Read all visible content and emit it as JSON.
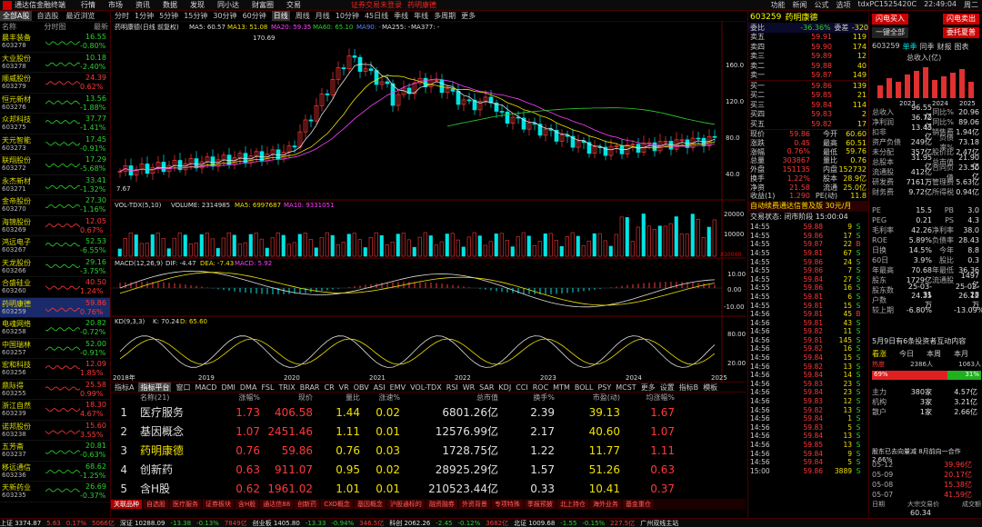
{
  "app": {
    "name": "通达信金融终端",
    "menu": [
      "行情",
      "市场",
      "资讯",
      "数据",
      "发现",
      "同小达",
      "财富圈",
      "交易"
    ],
    "warning": "证券交易未登录",
    "stock_title": "药明康德",
    "right_menu": [
      "功能",
      "新闻",
      "公式",
      "选项",
      "tdxPC1525420C",
      "22:49:04",
      "周二"
    ]
  },
  "left": {
    "tabs": [
      "全部A股",
      "自选股",
      "最近浏览"
    ],
    "head": [
      "名称",
      "分时图",
      "最新"
    ],
    "stocks": [
      {
        "name": "晨丰装备",
        "code": "603278",
        "price": "16.55",
        "chg": "-0.80%",
        "dir": "dn"
      },
      {
        "name": "大业股份",
        "code": "603278",
        "price": "10.18",
        "chg": "-2.40%",
        "dir": "dn"
      },
      {
        "name": "顺威股份",
        "code": "603279",
        "price": "24.39",
        "chg": "0.62%",
        "dir": "up"
      },
      {
        "name": "恒元新材",
        "code": "603276",
        "price": "13.56",
        "chg": "-1.88%",
        "dir": "dn"
      },
      {
        "name": "众邦科技",
        "code": "603275",
        "price": "37.77",
        "chg": "-1.41%",
        "dir": "dn"
      },
      {
        "name": "天元智能",
        "code": "603273",
        "price": "17.45",
        "chg": "-0.91%",
        "dir": "dn"
      },
      {
        "name": "联翔股份",
        "code": "603272",
        "price": "17.29",
        "chg": "-5.68%",
        "dir": "dn"
      },
      {
        "name": "永杰新材",
        "code": "603271",
        "price": "33.41",
        "chg": "-1.32%",
        "dir": "dn"
      },
      {
        "name": "金帝股份",
        "code": "603270",
        "price": "27.30",
        "chg": "-1.16%",
        "dir": "dn"
      },
      {
        "name": "海锦股份",
        "code": "603269",
        "price": "12.05",
        "chg": "0.67%",
        "dir": "up"
      },
      {
        "name": "鸿远电子",
        "code": "603267",
        "price": "52.53",
        "chg": "-6.55%",
        "dir": "dn"
      },
      {
        "name": "天龙股份",
        "code": "603266",
        "price": "29.16",
        "chg": "-3.75%",
        "dir": "dn"
      },
      {
        "name": "合盛硅业",
        "code": "603260",
        "price": "40.50",
        "chg": "1.24%",
        "dir": "up"
      },
      {
        "name": "药明康德",
        "code": "603259",
        "price": "59.86",
        "chg": "0.76%",
        "dir": "up",
        "selected": true
      },
      {
        "name": "电魂网络",
        "code": "603258",
        "price": "20.82",
        "chg": "-0.72%",
        "dir": "dn"
      },
      {
        "name": "中国瑞林",
        "code": "603257",
        "price": "52.00",
        "chg": "-0.91%",
        "dir": "dn"
      },
      {
        "name": "宏和科技",
        "code": "603256",
        "price": "12.09",
        "chg": "1.85%",
        "dir": "up"
      },
      {
        "name": "鼎际得",
        "code": "603255",
        "price": "25.58",
        "chg": "0.99%",
        "dir": "up"
      },
      {
        "name": "浙江自然",
        "code": "603239",
        "price": "18.30",
        "chg": "4.67%",
        "dir": "up"
      },
      {
        "name": "诺邦股份",
        "code": "603238",
        "price": "15.60",
        "chg": "3.55%",
        "dir": "up"
      },
      {
        "name": "五芳斋",
        "code": "603237",
        "price": "20.81",
        "chg": "-0.63%",
        "dir": "dn"
      },
      {
        "name": "移远通信",
        "code": "603236",
        "price": "68.62",
        "chg": "-1.25%",
        "dir": "dn"
      },
      {
        "name": "天新药业",
        "code": "603235",
        "price": "26.69",
        "chg": "-0.37%",
        "dir": "dn"
      }
    ]
  },
  "chart_toolbar": [
    "分时",
    "1分钟",
    "5分钟",
    "15分钟",
    "30分钟",
    "60分钟",
    "日线",
    "周线",
    "月线",
    "10分钟",
    "45日线",
    "季线",
    "年线",
    "多周期",
    "更多"
  ],
  "chart_toolbar_active": "日线",
  "main_chart": {
    "title": "药明康德(日线 前复权)",
    "ma_labels": [
      "MA5: 60.57",
      "MA13: 51.08",
      "MA20: 59.35",
      "MA60: 65.10",
      "MA90: -",
      "MA255: -",
      "MA377: -"
    ],
    "high_label": "170.69",
    "low_label": "7.67",
    "y_ticks": [
      "160.0",
      "120.0",
      "80.0",
      "40.0"
    ]
  },
  "vol_panel": {
    "title": "VOL-TDX(5,10)",
    "labels": [
      "VOLUME: 2314985",
      "MA5: 6997687",
      "MA10: 9331051"
    ],
    "y_ticks": [
      "20000",
      "10000",
      "X10000"
    ]
  },
  "macd_panel": {
    "title": "MACD(12,26,9)",
    "labels": [
      "DIF: -4.47",
      "DEA: -7.43",
      "MACD: 5.92"
    ],
    "y_ticks": [
      "10.00",
      "0.00",
      "-10.00"
    ]
  },
  "kdj_panel": {
    "title": "KD(9,3,3)",
    "labels": [
      "K: 70.24",
      "D: 65.60"
    ],
    "y_ticks": [
      "80.00",
      "20.00"
    ]
  },
  "x_axis": [
    "2018年",
    "2019",
    "2020",
    "2021",
    "2022",
    "2023",
    "2024",
    "2025"
  ],
  "bottom_tabs": [
    "指标A",
    "指标平台",
    "窗口",
    "MACD",
    "DMI",
    "DMA",
    "FSL",
    "TRIX",
    "BRAR",
    "CR",
    "VR",
    "OBV",
    "ASI",
    "EMV",
    "VOL-TDX",
    "RSI",
    "WR",
    "SAR",
    "KDJ",
    "CCI",
    "ROC",
    "MTM",
    "BOLL",
    "PSY",
    "MCST",
    "更多",
    "设置",
    "指标B",
    "模板"
  ],
  "bottom_tab_active": "指标平台",
  "table": {
    "head": [
      "",
      "名称(21)",
      "涨幅%",
      "现价",
      "量比",
      "涨速%",
      "总市值",
      "换手%",
      "市盈(动)",
      "均涨幅%"
    ],
    "rows": [
      [
        "1",
        "医疗服务",
        "1.73",
        "406.58",
        "1.44",
        "0.02",
        "6801.26亿",
        "2.39",
        "39.13",
        "1.67"
      ],
      [
        "2",
        "基因概念",
        "1.07",
        "2451.46",
        "1.11",
        "0.01",
        "12576.99亿",
        "2.17",
        "40.60",
        "1.07"
      ],
      [
        "3",
        "药明康德",
        "0.76",
        "59.86",
        "0.76",
        "0.03",
        "1728.75亿",
        "1.22",
        "11.77",
        "1.11"
      ],
      [
        "4",
        "创新药",
        "0.63",
        "911.07",
        "0.95",
        "0.02",
        "28925.29亿",
        "1.57",
        "51.26",
        "0.63"
      ],
      [
        "5",
        "含H股",
        "0.62",
        "1961.02",
        "1.01",
        "0.01",
        "210523.44亿",
        "0.33",
        "10.41",
        "0.37"
      ]
    ]
  },
  "sectors": [
    "关联品种",
    "自选股",
    "医疗服务",
    "证券板块",
    "含H股",
    "通达信88",
    "创新药",
    "CXO概念",
    "基因概念",
    "沪股通标的",
    "融资融券",
    "外资背景",
    "专项特殊",
    "季报预披",
    "北上持仓",
    "海外业务",
    "基金重仓"
  ],
  "sector_active": "关联品种",
  "status": [
    "上证 3374.87",
    "5.63",
    "0.17%",
    "5066亿",
    "深证 10288.09",
    "-13.38",
    "-0.13%",
    "7849亿",
    "创业板 1405.80",
    "-13.33",
    "-0.94%",
    "346.5亿",
    "科创 2062.26",
    "-2.45",
    "-0.12%",
    "3682亿",
    "北证 1009.68",
    "-1.55",
    "-0.15%",
    "227.5亿",
    "广州双线主站"
  ],
  "quote": {
    "code": "603259",
    "name": "药明康德",
    "ratio_label": "委比",
    "ratio": "-36.36%",
    "diff_label": "委差",
    "diff": "-320",
    "sells": [
      [
        "卖五",
        "59.91",
        "119"
      ],
      [
        "卖四",
        "59.90",
        "174"
      ],
      [
        "卖三",
        "59.89",
        "12"
      ],
      [
        "卖二",
        "59.88",
        "40"
      ],
      [
        "卖一",
        "59.87",
        "149"
      ]
    ],
    "buys": [
      [
        "买一",
        "59.86",
        "139"
      ],
      [
        "买二",
        "59.85",
        "21"
      ],
      [
        "买三",
        "59.84",
        "114"
      ],
      [
        "买四",
        "59.83",
        "2"
      ],
      [
        "买五",
        "59.82",
        "17"
      ]
    ],
    "stats": [
      [
        "现价",
        "59.86",
        "今开",
        "60.60"
      ],
      [
        "涨跌",
        "0.45",
        "最高",
        "60.51"
      ],
      [
        "涨幅",
        "0.76%",
        "最低",
        "59.76"
      ],
      [
        "总量",
        "303867",
        "量比",
        "0.76"
      ],
      [
        "外盘",
        "151135",
        "内盘",
        "152732"
      ],
      [
        "换手",
        "1.22%",
        "股本",
        "28.9亿"
      ],
      [
        "净资",
        "21.58",
        "流通",
        "25.0亿"
      ],
      [
        "收益(1)",
        "1.290",
        "PE(动)",
        "11.8"
      ]
    ],
    "ad": "自动续费通达信普及版 30元/月",
    "status": "交易状态: 闭市阶段 15:00:04",
    "ticks": [
      [
        "14:55",
        "59.88",
        "9",
        "S"
      ],
      [
        "14:55",
        "59.86",
        "17",
        "S"
      ],
      [
        "14:55",
        "59.87",
        "22",
        "B"
      ],
      [
        "14:55",
        "59.81",
        "67",
        "S"
      ],
      [
        "14:55",
        "59.86",
        "24",
        "S"
      ],
      [
        "14:55",
        "59.86",
        "7",
        "S"
      ],
      [
        "14:55",
        "59.84",
        "27",
        "S"
      ],
      [
        "14:55",
        "59.86",
        "16",
        "S"
      ],
      [
        "14:55",
        "59.81",
        "6",
        "S"
      ],
      [
        "14:55",
        "59.81",
        "15",
        "S"
      ],
      [
        "14:56",
        "59.81",
        "45",
        "B"
      ],
      [
        "14:56",
        "59.81",
        "43",
        "S"
      ],
      [
        "14:56",
        "59.82",
        "11",
        "S"
      ],
      [
        "14:56",
        "59.81",
        "145",
        "S"
      ],
      [
        "14:56",
        "59.82",
        "16",
        "S"
      ],
      [
        "14:56",
        "59.84",
        "15",
        "S"
      ],
      [
        "14:56",
        "59.82",
        "13",
        "S"
      ],
      [
        "14:56",
        "59.84",
        "14",
        "S"
      ],
      [
        "14:56",
        "59.83",
        "23",
        "S"
      ],
      [
        "14:56",
        "59.84",
        "23",
        "S"
      ],
      [
        "14:56",
        "59.83",
        "12",
        "S"
      ],
      [
        "14:56",
        "59.82",
        "13",
        "S"
      ],
      [
        "14:56",
        "59.84",
        "1",
        "S"
      ],
      [
        "14:56",
        "59.83",
        "5",
        "S"
      ],
      [
        "14:56",
        "59.84",
        "13",
        "S"
      ],
      [
        "14:56",
        "59.85",
        "13",
        "S"
      ],
      [
        "14:56",
        "59.84",
        "9",
        "S"
      ],
      [
        "14:56",
        "59.84",
        "5",
        "S"
      ],
      [
        "15:00",
        "59.86",
        "3889",
        "S"
      ]
    ]
  },
  "rside": {
    "buttons": [
      "闪电买入",
      "闪电卖出",
      "一键全部",
      "委托夏普"
    ],
    "code": "603259",
    "tabs": [
      "单季",
      "同季",
      "财报",
      "图表"
    ],
    "chart_title": "总收入(亿)",
    "years": [
      "2023",
      "2024",
      "2025"
    ],
    "fin": [
      [
        "总收入",
        "96.55亿",
        "同比%",
        "20.96"
      ],
      [
        "净利润",
        "36.72亿",
        "同比%",
        "89.06"
      ],
      [
        "扣非",
        "13.43亿",
        "销售费",
        "1.94亿"
      ],
      [
        "资产负债",
        "249亿",
        "负债率%",
        "73.18"
      ],
      [
        "未分配",
        "357亿",
        "股价比",
        "2.47亿"
      ],
      [
        "总股本",
        "31.95亿",
        "总市值",
        "21.90亿"
      ],
      [
        "流通股",
        "412亿",
        "合同负债",
        "23.50亿"
      ],
      [
        "研发费",
        "7161万",
        "管理费",
        "5.63亿"
      ],
      [
        "财务费",
        "9.72亿",
        "所得税",
        "0.94亿"
      ]
    ],
    "metrics": [
      [
        "PE",
        "15.5",
        "PB",
        "3.0"
      ],
      [
        "PEG",
        "0.21",
        "PS",
        "4.3"
      ],
      [
        "毛利率",
        "42.26",
        "净利率",
        "38.0"
      ],
      [
        "ROE",
        "5.89%",
        "负债率",
        "28.43"
      ],
      [
        "日换",
        "14.5%",
        "今年",
        "8.8"
      ],
      [
        "60日",
        "3.9%",
        "股比",
        "0.3"
      ],
      [
        "年最高",
        "70.68",
        "年最低",
        "36.36"
      ],
      [
        "股东",
        "1729亿",
        "流通股",
        "1497亿"
      ],
      [
        "股东数",
        "25-03-31",
        "",
        "25-02-28"
      ],
      [
        "户数",
        "24.35万",
        "",
        "26.12万"
      ],
      [
        "较上期",
        "-6.80%",
        "",
        "-13.09%"
      ]
    ],
    "note": "5月9日有6条投资者互动内容",
    "sentiment": {
      "label": "看涨",
      "periods": [
        "今日",
        "本周",
        "本月"
      ],
      "score_label": "热度",
      "score": "2386人",
      "people": "1063人",
      "up": "69%",
      "down": "31%"
    },
    "flows": [
      [
        "主力",
        "380家",
        "4.57亿"
      ],
      [
        "机构",
        "3家",
        "3.21亿"
      ],
      [
        "散户",
        "1家",
        "2.66亿"
      ]
    ],
    "overlay": "股东已去向量减 8月前向一合作 2.66%",
    "dates": [
      [
        "05-12",
        "",
        "39.96亿"
      ],
      [
        "05-09",
        "",
        "20.17亿"
      ],
      [
        "05-08",
        "",
        "15.38亿"
      ],
      [
        "05-07",
        "",
        "41.59亿"
      ]
    ],
    "footer": [
      "日期",
      "大宗交易价",
      "成交额"
    ],
    "footer_val": "60.34"
  },
  "chart_data": {
    "type": "candlestick",
    "title": "药明康德(日线 前复权)",
    "x_range": [
      "2018",
      "2025"
    ],
    "ylim": [
      7.67,
      170.69
    ],
    "peak": 170.69,
    "last_close": 59.86
  }
}
